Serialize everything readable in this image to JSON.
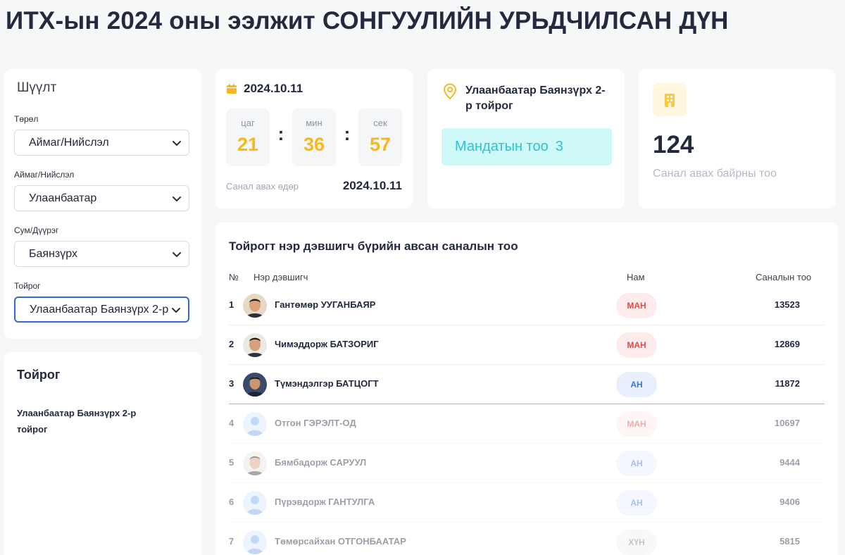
{
  "page": {
    "title": "ИТХ-ын 2024 оны ээлжит СОНГУУЛИЙН УРЬДЧИЛСАН ДҮН"
  },
  "filter": {
    "heading": "Шүүлт",
    "type": {
      "label": "Төрөл",
      "value": "Аймаг/Нийслэл"
    },
    "province": {
      "label": "Аймаг/Нийслэл",
      "value": "Улаанбаатар"
    },
    "district": {
      "label": "Сум/Дүүрэг",
      "value": "Баянзүрх"
    },
    "constituency": {
      "label": "Тойрог",
      "value": "Улаанбаатар Баянзүрх 2-р"
    }
  },
  "district_panel": {
    "title": "Тойрог",
    "name": "Улаанбаатар Баянзүрх 2-р тойрог"
  },
  "countdown": {
    "date": "2024.10.11",
    "hours_label": "цаг",
    "hours": "21",
    "minutes_label": "мин",
    "minutes": "36",
    "seconds_label": "сек",
    "seconds": "57",
    "separator": ":",
    "vote_day_label": "Санал авах өдөр",
    "vote_day": "2024.10.11"
  },
  "location": {
    "name": "Улаанбаатар Баянзүрх 2-р тойрог",
    "mandate_label": "Мандатын тоо",
    "mandate_count": "3"
  },
  "polling": {
    "count": "124",
    "label": "Санал авах байрны тоо"
  },
  "results": {
    "title": "Тойрогт нэр дэвшигч бүрийн авсан саналын тоо",
    "columns": {
      "num": "№",
      "name": "Нэр дэвшигч",
      "party": "Нам",
      "votes": "Саналын тоо"
    },
    "rows": [
      {
        "num": "1",
        "name": "Гантөмөр УУГАНБАЯР",
        "party": "МАН",
        "votes": "13523"
      },
      {
        "num": "2",
        "name": "Чимэддорж БАТЗОРИГ",
        "party": "МАН",
        "votes": "12869"
      },
      {
        "num": "3",
        "name": "Түмэндэлгэр БАТЦОГТ",
        "party": "АН",
        "votes": "11872"
      },
      {
        "num": "4",
        "name": "Отгон ГЭРЭЛТ-ОД",
        "party": "МАН",
        "votes": "10697"
      },
      {
        "num": "5",
        "name": "Бямбадорж САРУУЛ",
        "party": "АН",
        "votes": "9444"
      },
      {
        "num": "6",
        "name": "Пүрэвдорж ГАНТУЛГА",
        "party": "АН",
        "votes": "9406"
      },
      {
        "num": "7",
        "name": "Төмөрсайхан ОТГОНБААТАР",
        "party": "ХҮН",
        "votes": "5815"
      }
    ]
  },
  "colors": {
    "accent_yellow": "#f6b81d",
    "mandate_teal": "#2fc3cd",
    "party_red": "#e24a48",
    "party_blue": "#3b76dd"
  }
}
